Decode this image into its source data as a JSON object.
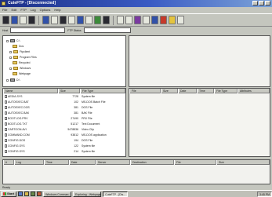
{
  "window": {
    "title": "CuteFTP - [Disconnected]"
  },
  "menu": [
    "File",
    "Edit",
    "FTP",
    "Log",
    "Options",
    "Help"
  ],
  "toolbar": {
    "icons": [
      "connect-icon",
      "disconnect-icon",
      "reconnect-icon",
      "download-icon",
      "upload-icon",
      "view-icon",
      "delete-icon",
      "rename-icon",
      "refresh-icon",
      "stop-icon",
      "queue-icon",
      "log-icon",
      "help-icon",
      "settings-icon",
      "red-x-icon",
      "flag-icon",
      "question-icon"
    ]
  },
  "address_bar": {
    "host_label": "Host",
    "user_label": "User",
    "port_label": "FTP Status",
    "host_value": "",
    "user_value": ""
  },
  "tree": [
    {
      "label": "C:\\",
      "type": "drive",
      "indent": 0
    },
    {
      "label": "Dos",
      "type": "folder",
      "indent": 1
    },
    {
      "label": "Ftpclient",
      "type": "folder",
      "indent": 1
    },
    {
      "label": "Program Files",
      "type": "folder",
      "indent": 1
    },
    {
      "label": "Recycled",
      "type": "folder",
      "indent": 1
    },
    {
      "label": "Windows",
      "type": "folder",
      "indent": 1
    },
    {
      "label": "Webpage",
      "type": "folder",
      "indent": 1
    },
    {
      "label": "D:\\",
      "type": "drive",
      "indent": 0
    }
  ],
  "local_list": {
    "headers": [
      "Name",
      "Size",
      "File Type"
    ],
    "rows": [
      [
        "AEDIA.SYS",
        "7728",
        "System file"
      ],
      [
        "AUTOEXEC.BAT",
        "102",
        "MS-DOS Batch File"
      ],
      [
        "AUTOEXEC.DOS",
        "381",
        "DOS File"
      ],
      [
        "AUTOEXEC.BAK",
        "381",
        "BAK File"
      ],
      [
        "BOOTLOG.PRV",
        "27490",
        "PRV File"
      ],
      [
        "BOOTLOG.TXT",
        "51217",
        "Text Document"
      ],
      [
        "CARTOON.AVI",
        "5478836",
        "Video Clip"
      ],
      [
        "COMMAND.COM",
        "93812",
        "MS-DOS application"
      ],
      [
        "CONFIG.DOS",
        "194",
        "DOS File"
      ],
      [
        "CONFIG.SYS",
        "122",
        "System file"
      ],
      [
        "CONFIG.SYS",
        "214",
        "System file"
      ]
    ]
  },
  "remote_list": {
    "headers": [
      "File",
      "Size",
      "Date",
      "Time",
      "File Type",
      "Attributes"
    ]
  },
  "log": {
    "headers": [
      "#",
      "Log",
      "Time",
      "Date",
      "Server",
      "Destination",
      "File",
      "Size"
    ]
  },
  "status": "Ready",
  "taskbar": {
    "start_label": "Start",
    "buttons": [
      "Windows Comman...",
      "Exploring - Webpage",
      "CuteFTP - [Dis..."
    ],
    "clock": "3:45 PM"
  }
}
